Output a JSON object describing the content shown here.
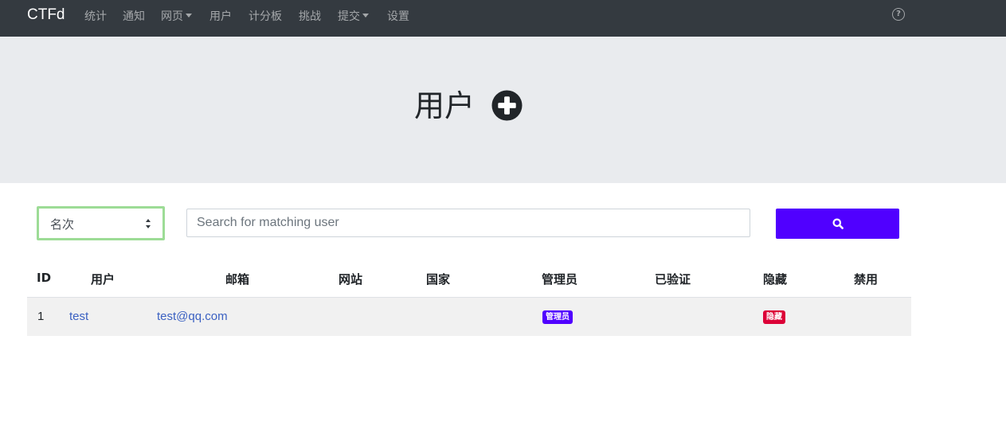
{
  "navbar": {
    "brand": "CTFd",
    "items": [
      {
        "label": "统计",
        "dropdown": false
      },
      {
        "label": "通知",
        "dropdown": false
      },
      {
        "label": "网页",
        "dropdown": true
      },
      {
        "label": "用户",
        "dropdown": false
      },
      {
        "label": "计分板",
        "dropdown": false
      },
      {
        "label": "挑战",
        "dropdown": false
      },
      {
        "label": "提交",
        "dropdown": true
      },
      {
        "label": "设置",
        "dropdown": false
      }
    ],
    "help_icon": "question-circle-icon"
  },
  "header": {
    "title": "用户",
    "add_icon": "plus-circle-icon"
  },
  "search": {
    "field_selected": "名次",
    "placeholder": "Search for matching user",
    "value": "",
    "button_icon": "search-icon",
    "button_color": "#5000ff"
  },
  "table": {
    "columns": [
      "ID",
      "用户",
      "邮箱",
      "网站",
      "国家",
      "管理员",
      "已验证",
      "隐藏",
      "禁用"
    ],
    "rows": [
      {
        "id": "1",
        "user": "test",
        "email": "test@qq.com",
        "website": "",
        "country": "",
        "admin_badge": "管理员",
        "verified": "",
        "hidden_badge": "隐藏",
        "banned": ""
      }
    ]
  },
  "colors": {
    "navbar_bg": "#343a40",
    "jumbotron_bg": "#e9ebee",
    "link": "#3b61c2",
    "admin_badge": "#5000ff",
    "hidden_badge": "#dc0037"
  }
}
